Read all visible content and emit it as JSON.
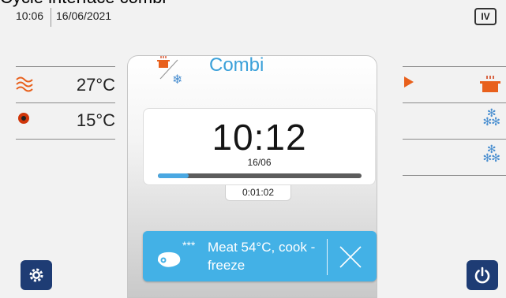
{
  "caption": "Cycle interface combi",
  "header": {
    "time": "10:06",
    "date": "16/06/2021",
    "level_badge": "IV"
  },
  "left_sensors": [
    {
      "icon": "heat-wave-icon",
      "value": "27°C"
    },
    {
      "icon": "core-probe-icon",
      "value": "15°C"
    }
  ],
  "right_steps": [
    {
      "icon": "cooking-pot-icon",
      "active": true
    },
    {
      "icon": "snowflake-icon",
      "active": false
    },
    {
      "icon": "snowflake-icon",
      "active": false
    }
  ],
  "mode": {
    "icon": "combi-pot-snowflake-icon",
    "title": "Combi"
  },
  "clock": {
    "time": "10:12",
    "date": "16/06",
    "progress": 0.15,
    "elapsed": "0:01:02"
  },
  "recipe": {
    "stars": "***",
    "label": "Meat 54°C, cook - freeze",
    "icon": "meat-icon"
  },
  "buttons": {
    "settings": "gear-icon",
    "power": "power-icon",
    "cancel": "close-icon"
  },
  "colors": {
    "accent": "#43b1e6",
    "heat": "#e8601c",
    "cold": "#4a8fd0",
    "button_dark": "#1e3c74"
  }
}
